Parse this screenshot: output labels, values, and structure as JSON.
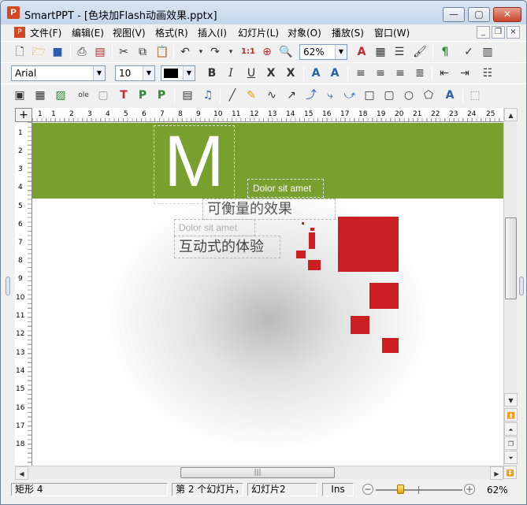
{
  "window": {
    "title": "SmartPPT - [色块加Flash动画效果.pptx]",
    "app_icon": "P",
    "buttons": {
      "minimize": "—",
      "maximize": "▢",
      "close": "✕"
    }
  },
  "menubar": {
    "items": [
      "文件(F)",
      "编辑(E)",
      "视图(V)",
      "格式(R)",
      "插入(I)",
      "幻灯片(L)",
      "对象(O)",
      "播放(S)",
      "窗口(W)"
    ],
    "mdi": {
      "minimize": "_",
      "restore": "❐",
      "close": "×"
    }
  },
  "toolbar1": {
    "zoom_value": "62%"
  },
  "toolbar2": {
    "font_name": "Arial",
    "font_size": "10",
    "color_swatch": "#000000"
  },
  "ruler": {
    "h_numbers": [
      "1",
      "1",
      "2",
      "3",
      "4",
      "5",
      "6",
      "7",
      "8",
      "9",
      "10",
      "11",
      "12",
      "13",
      "14",
      "15",
      "16",
      "17",
      "18",
      "19",
      "20",
      "21",
      "22",
      "23",
      "24",
      "25"
    ],
    "v_numbers": [
      "1",
      "2",
      "3",
      "4",
      "5",
      "6",
      "7",
      "8",
      "9",
      "10",
      "11",
      "12",
      "13",
      "14",
      "15",
      "16",
      "17",
      "18"
    ]
  },
  "slide": {
    "colors": {
      "green": "#77a02e",
      "red": "#cc1f24"
    },
    "big_letter": "M",
    "dolor_1": "Dolor sit amet",
    "heading_1": "可衡量的效果",
    "dolor_2": "Dolor sit amet",
    "heading_2": "互动式的体验"
  },
  "statusbar": {
    "shape": "矩形 4",
    "slide_index": "第 2 个幻灯片，",
    "slide_name": "幻灯片2",
    "mode": "Ins",
    "zoom": "62%"
  }
}
